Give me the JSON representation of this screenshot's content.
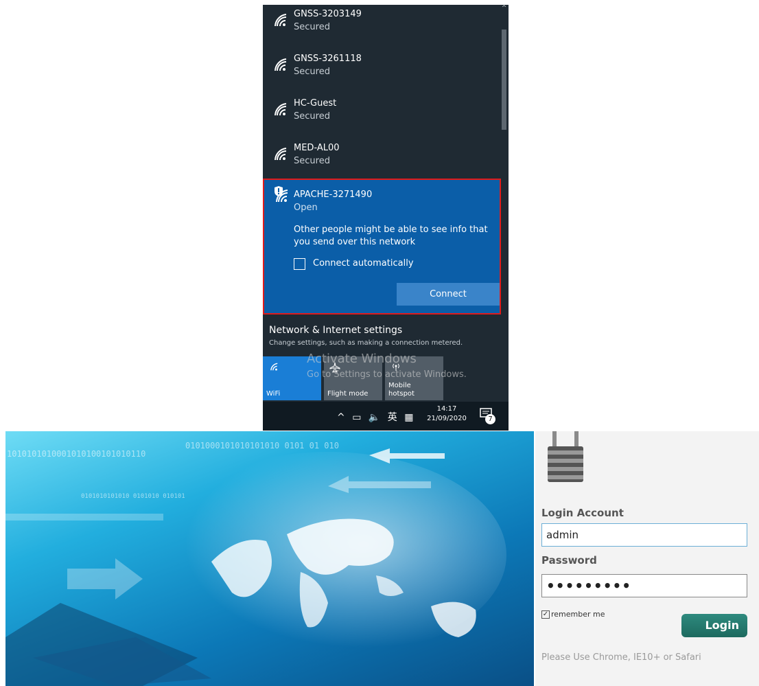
{
  "wifi_flyout": {
    "networks": [
      {
        "ssid": "GNSS-3203149",
        "status": "Secured",
        "icon": "wifi-signal-icon"
      },
      {
        "ssid": "GNSS-3261118",
        "status": "Secured",
        "icon": "wifi-signal-icon"
      },
      {
        "ssid": "HC-Guest",
        "status": "Secured",
        "icon": "wifi-signal-icon"
      },
      {
        "ssid": "MED-AL00",
        "status": "Secured",
        "icon": "wifi-signal-icon"
      }
    ],
    "selected_network": {
      "ssid": "APACHE-3271490",
      "status": "Open",
      "warning": "Other people might be able to see info that you send over this network",
      "connect_automatically_label": "Connect automatically",
      "connect_automatically_checked": false,
      "connect_button": "Connect",
      "icon": "wifi-open-shield-icon",
      "highlight_color": "#e01b1b"
    },
    "settings": {
      "title": "Network & Internet settings",
      "subtitle": "Change settings, such as making a connection metered."
    },
    "quick_actions": [
      {
        "label": "WiFi",
        "icon": "wifi-icon",
        "active": true
      },
      {
        "label": "Flight mode",
        "icon": "airplane-icon",
        "active": false
      },
      {
        "label": "Mobile hotspot",
        "icon": "hotspot-icon",
        "active": false
      }
    ],
    "watermark": {
      "line1": "Activate Windows",
      "line2": "Go to Settings to activate Windows."
    },
    "taskbar": {
      "chevron": "^",
      "ime": "英",
      "time": "14:17",
      "date": "21/09/2020",
      "notifications": "7"
    },
    "colors": {
      "flyout_bg": "#1f2a33",
      "selected_bg": "#0b5ea8",
      "accent": "#1a7ed6"
    }
  },
  "login": {
    "banner_binary": [
      "0101000101010101010    0101  01 010",
      "1010101010001010100101010110",
      "0101010101010  0101010  010101"
    ],
    "account_label": "Login Account",
    "account_value": "admin",
    "password_label": "Password",
    "password_value": "•••••••••",
    "remember_label": "remember me",
    "remember_checked": true,
    "login_button": "Login",
    "browser_hint": "Please Use Chrome, IE10+ or Safari",
    "colors": {
      "button": "#1d6a5f",
      "input_border": "#6aaed6"
    }
  }
}
